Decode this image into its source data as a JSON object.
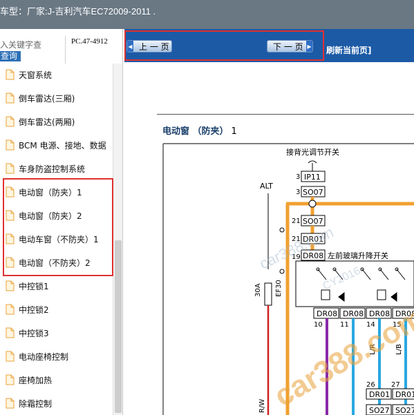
{
  "window": {
    "title": "车型：厂家:J-吉利汽车EC72009-2011    ."
  },
  "search": {
    "placeholder": "入关键字查",
    "pc_code": "PC.47-4912",
    "query_label": "查询"
  },
  "sidebar": {
    "items": [
      {
        "label": "天窗系统"
      },
      {
        "label": "倒车雷达(三厢)"
      },
      {
        "label": "倒车雷达(两厢)"
      },
      {
        "label": "BCM 电源、接地、数据"
      },
      {
        "label": "车身防盗控制系统"
      },
      {
        "label": "电动窗（防夹）1"
      },
      {
        "label": "电动窗（防夹）2"
      },
      {
        "label": "电动车窗（不防夹）1"
      },
      {
        "label": "电动窗（不防夹）2"
      },
      {
        "label": "中控锁1"
      },
      {
        "label": "中控锁2"
      },
      {
        "label": "中控锁3"
      },
      {
        "label": "电动座椅控制"
      },
      {
        "label": "座椅加热"
      },
      {
        "label": "除霜控制"
      }
    ]
  },
  "toolbar": {
    "prev_label": "上 一 页",
    "next_label": "下 一 页",
    "refresh_label": "刷新当前页]"
  },
  "document": {
    "title": "电动窗 （防夹）",
    "page_number": "1",
    "diagram": {
      "backlight_switch": "接背光调节开关",
      "alt_label": "ALT",
      "connectors": {
        "c1": "3",
        "c1_name": "IP11",
        "c2": "3",
        "c2_name": "SO07",
        "c3": "21",
        "c3_name": "SO07",
        "c4": "21",
        "c4_name": "DR01",
        "c5": "19",
        "c5_name": "DR08"
      },
      "window_switch": "左前玻璃升降开关",
      "fuse_rating": "30A",
      "fuse_name": "EF30",
      "bottom_connectors": [
        "DR08",
        "DR08",
        "DR08",
        "DR08"
      ],
      "bottom_pins": [
        "10",
        "11",
        "14",
        "15"
      ],
      "wire_colors": [
        "L/R",
        "L/B"
      ],
      "lower_pins": [
        "26",
        "27"
      ],
      "lower_connectors": [
        "DR01",
        "DR01"
      ],
      "lowest_connectors": [
        "SO27",
        "SO27"
      ],
      "rw_label": "R/W"
    },
    "watermarks": {
      "big": "car388.com",
      "mid": "car388.com",
      "small": "CY2016"
    }
  },
  "colors": {
    "titlebar_bg": "#6a7884",
    "toolbar_bg": "#1c5aa6",
    "highlight_red": "#e03030",
    "wire_orange": "#f0a030",
    "wire_red": "#d02020",
    "wire_purple": "#8a2aa8",
    "wire_blue": "#2aa8e0"
  }
}
